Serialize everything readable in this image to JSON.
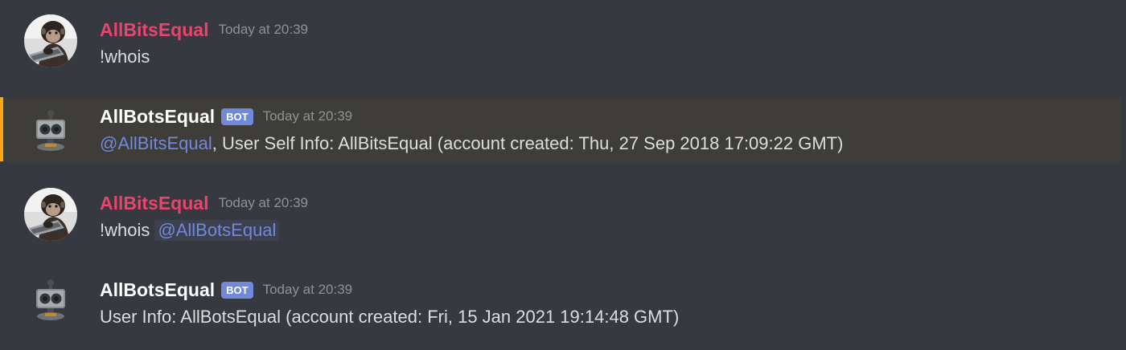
{
  "messages": [
    {
      "author": "AllBitsEqual",
      "timestamp": "Today at 20:39",
      "content": "!whois",
      "avatar_icon": "chimpanzee-avatar",
      "author_color": "#e9436e"
    },
    {
      "author": "AllBotsEqual",
      "badge": "BOT",
      "timestamp": "Today at 20:39",
      "mention": "@AllBitsEqual",
      "content": ", User Self Info: AllBitsEqual (account created: Thu, 27 Sep 2018 17:09:22 GMT)",
      "avatar_icon": "robot-avatar",
      "highlight_color": "#faa61a"
    },
    {
      "author": "AllBitsEqual",
      "timestamp": "Today at 20:39",
      "content": "!whois",
      "mention": "@AllBotsEqual",
      "avatar_icon": "chimpanzee-avatar",
      "author_color": "#e9436e"
    },
    {
      "author": "AllBotsEqual",
      "badge": "BOT",
      "timestamp": "Today at 20:39",
      "content": "User Info: AllBotsEqual (account created: Fri, 15 Jan 2021 19:14:48 GMT)",
      "avatar_icon": "robot-avatar"
    }
  ],
  "colors": {
    "background": "#36393f",
    "highlight_background": "#3f3d3a",
    "mention": "#7289da",
    "bot_badge": "#7289da"
  }
}
